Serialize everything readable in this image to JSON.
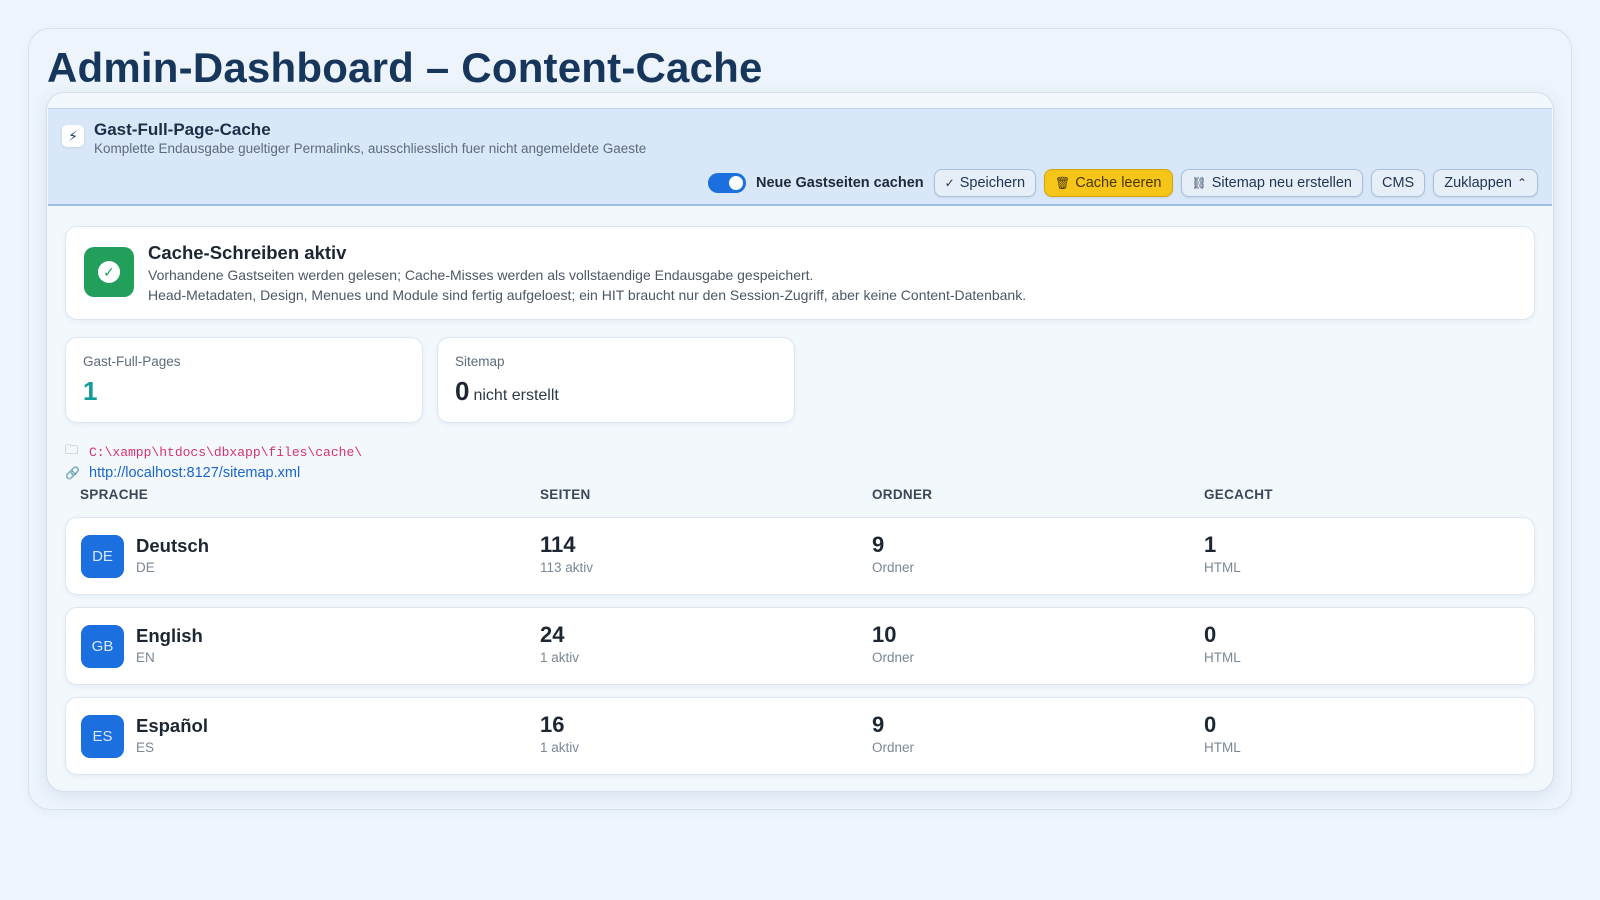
{
  "page_title": "Admin-Dashboard – Content-Cache",
  "header": {
    "icon": "bolt-icon",
    "title": "Gast-Full-Page-Cache",
    "subtitle": "Komplette Endausgabe gueltiger Permalinks, ausschliesslich fuer nicht angemeldete Gaeste",
    "toggle_on": true,
    "toggle_label": "Neue Gastseiten cachen",
    "buttons": {
      "save": "Speichern",
      "clear_cache": "Cache leeren",
      "sitemap": "Sitemap neu erstellen",
      "cms": "CMS",
      "collapse": "Zuklappen"
    }
  },
  "status": {
    "title": "Cache-Schreiben aktiv",
    "line1": "Vorhandene Gastseiten werden gelesen; Cache-Misses werden als vollstaendige Endausgabe gespeichert.",
    "line2": "Head-Metadaten, Design, Menues und Module sind fertig aufgeloest; ein HIT braucht nur den Session-Zugriff, aber keine Content-Datenbank.",
    "color": "#22a05b"
  },
  "stats": {
    "guest_pages": {
      "label": "Gast-Full-Pages",
      "value": "1"
    },
    "sitemap": {
      "label": "Sitemap",
      "value": "0",
      "suffix": "nicht erstellt"
    }
  },
  "cache_path": "C:\\xampp\\htdocs\\dbxapp\\files\\cache\\",
  "sitemap_url": "http://localhost:8127/sitemap.xml",
  "table": {
    "headers": {
      "language": "SPRACHE",
      "pages": "SEITEN",
      "folders": "ORDNER",
      "cached": "GECACHT"
    },
    "rows": [
      {
        "flag": "DE",
        "name": "Deutsch",
        "code": "DE",
        "pages": "114",
        "pages_sub": "113 aktiv",
        "folders": "9",
        "folders_sub": "Ordner",
        "cached": "1",
        "cached_sub": "HTML"
      },
      {
        "flag": "GB",
        "name": "English",
        "code": "EN",
        "pages": "24",
        "pages_sub": "1 aktiv",
        "folders": "10",
        "folders_sub": "Ordner",
        "cached": "0",
        "cached_sub": "HTML"
      },
      {
        "flag": "ES",
        "name": "Español",
        "code": "ES",
        "pages": "16",
        "pages_sub": "1 aktiv",
        "folders": "9",
        "folders_sub": "Ordner",
        "cached": "0",
        "cached_sub": "HTML"
      }
    ]
  },
  "colors": {
    "accent": "#1c6fde",
    "warning": "#f5c518",
    "teal": "#139c9c",
    "path": "#d6336c"
  }
}
